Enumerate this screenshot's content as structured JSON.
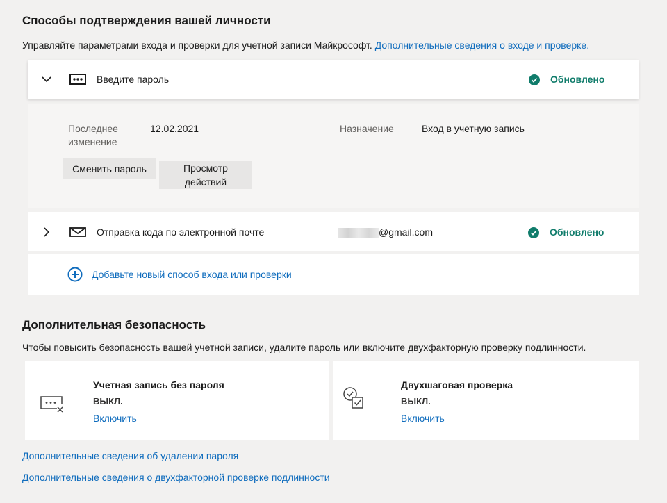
{
  "header": {
    "title": "Способы подтверждения вашей личности",
    "subtitle": "Управляйте параметрами входа и проверки для учетной записи Майкрософт.",
    "subtitle_link": "Дополнительные сведения о входе и проверке."
  },
  "methods": {
    "password": {
      "title": "Введите пароль",
      "status": "Обновлено",
      "details": {
        "last_changed_label_line1": "Последнее",
        "last_changed_label_line2": "изменение",
        "last_changed_value": "12.02.2021",
        "purpose_label": "Назначение",
        "purpose_value": "Вход в учетную запись",
        "change_button": "Сменить пароль",
        "view_activity_line1": "Просмотр",
        "view_activity_line2": "действий"
      }
    },
    "email": {
      "title": "Отправка кода по электронной почте",
      "address_visible": "@gmail.com",
      "status": "Обновлено"
    },
    "add_new": "Добавьте новый способ входа или проверки"
  },
  "security": {
    "title": "Дополнительная безопасность",
    "subtitle": "Чтобы повысить безопасность вашей учетной записи, удалите пароль или включите двухфакторную проверку подлинности.",
    "passwordless": {
      "title": "Учетная запись без пароля",
      "status": "ВЫКЛ.",
      "action": "Включить"
    },
    "two_step": {
      "title": "Двухшаговая проверка",
      "status": "ВЫКЛ.",
      "action": "Включить"
    }
  },
  "footer_links": {
    "remove_password": "Дополнительные сведения об удалении пароля",
    "two_factor": "Дополнительные сведения о двухфакторной проверке подлинности"
  },
  "colors": {
    "link": "#0f6cbd",
    "status_green": "#107c6b",
    "background": "#f2f1f0"
  },
  "icons": {
    "expand": "chevron-down-icon",
    "collapse": "chevron-right-icon",
    "password": "password-dots-icon",
    "email": "envelope-icon",
    "status": "checkmark-circle-icon",
    "add": "plus-circle-icon",
    "passwordless": "password-removed-icon",
    "two_step": "two-step-check-icon"
  }
}
